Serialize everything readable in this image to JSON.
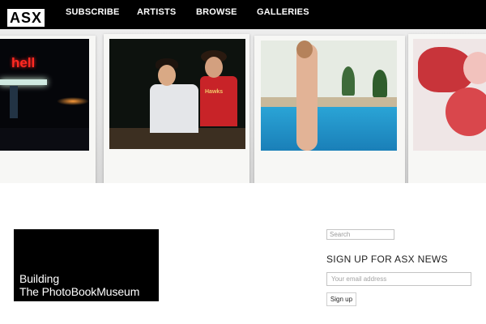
{
  "header": {
    "logo_text": "ASX",
    "nav": [
      {
        "label": "SUBSCRIBE"
      },
      {
        "label": "ARTISTS"
      },
      {
        "label": "BROWSE"
      },
      {
        "label": "GALLERIES"
      }
    ]
  },
  "banner": {
    "photos": [
      {
        "neon_text": "hell"
      },
      {
        "shirt_text": "Hawks"
      },
      {},
      {}
    ]
  },
  "promo": {
    "line1": "Building",
    "line2": "The PhotoBookMuseum"
  },
  "sidebar": {
    "search_placeholder": "Search",
    "newsletter_title": "SIGN UP FOR ASX NEWS",
    "email_placeholder": "Your email address",
    "signup_label": "Sign up"
  },
  "colors": {
    "navbar": "#000000",
    "nav_text": "#ffffff",
    "promo_bg": "#000000",
    "pool": "#2aa4d6",
    "neon_red": "#ff2a22"
  }
}
